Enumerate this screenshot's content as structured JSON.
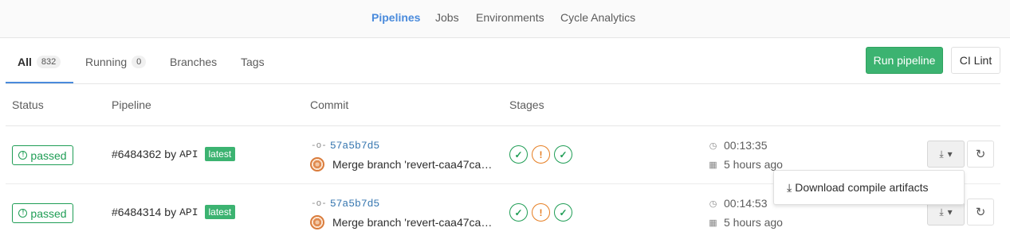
{
  "subnav": {
    "items": [
      "Pipelines",
      "Jobs",
      "Environments",
      "Cycle Analytics"
    ]
  },
  "tabs": [
    {
      "label": "All",
      "count": "832"
    },
    {
      "label": "Running",
      "count": "0"
    },
    {
      "label": "Branches"
    },
    {
      "label": "Tags"
    }
  ],
  "actions": {
    "run_pipeline": "Run pipeline",
    "ci_lint": "CI Lint"
  },
  "columns": [
    "Status",
    "Pipeline",
    "Commit",
    "Stages"
  ],
  "rows": [
    {
      "status": "passed",
      "pipeline_id": "#6484362",
      "by": "by",
      "trigger": "API",
      "badge": "latest",
      "sha": "57a5b7d5",
      "message": "Merge branch 'revert-caa47ca…",
      "duration": "00:13:35",
      "finished": "5 hours ago"
    },
    {
      "status": "passed",
      "pipeline_id": "#6484314",
      "by": "by",
      "trigger": "API",
      "badge": "latest",
      "sha": "57a5b7d5",
      "message": "Merge branch 'revert-caa47ca…",
      "duration": "00:14:53",
      "finished": "5 hours ago"
    }
  ],
  "dropdown": {
    "item": "Download compile artifacts"
  },
  "colors": {
    "accent": "#4a8bdc",
    "success": "#1f9d55",
    "run_button": "#3cb371",
    "warning": "#e67e22"
  }
}
